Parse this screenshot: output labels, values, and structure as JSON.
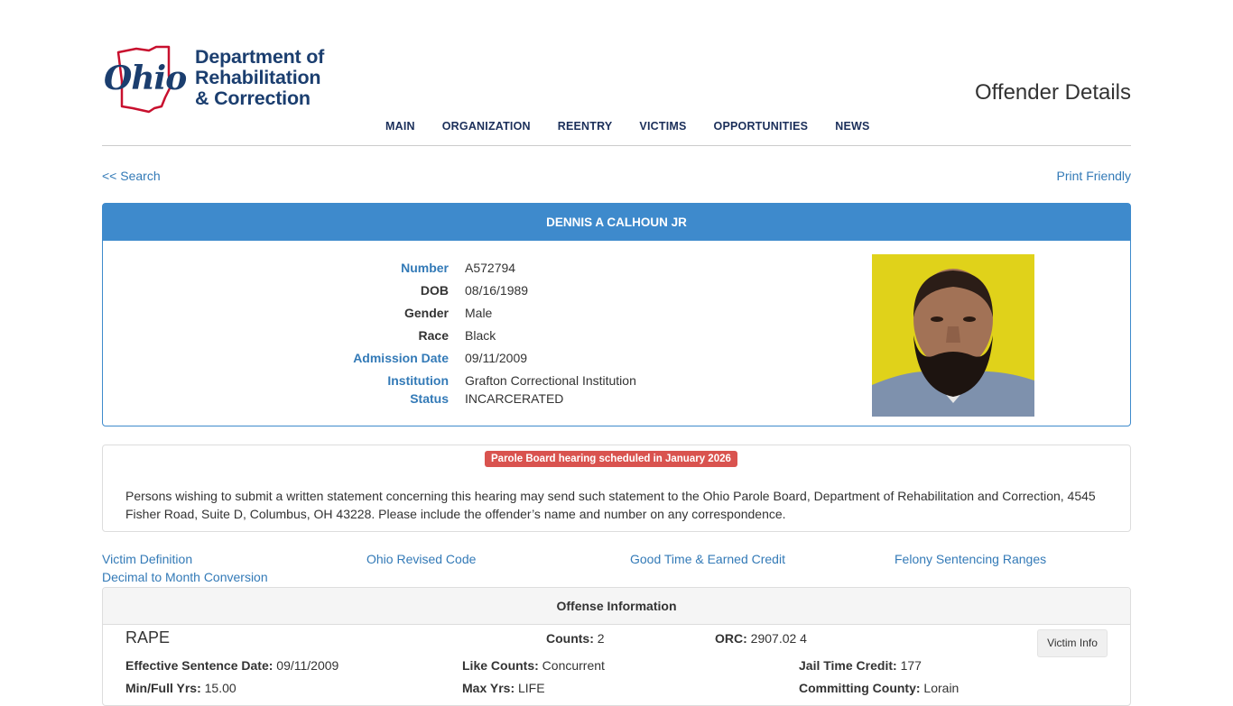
{
  "header": {
    "logo": {
      "script_word": "Ohio",
      "line1": "Department of",
      "line2": "Rehabilitation",
      "line3": "& Correction"
    },
    "page_title": "Offender Details",
    "nav": [
      "MAIN",
      "ORGANIZATION",
      "REENTRY",
      "VICTIMS",
      "OPPORTUNITIES",
      "NEWS"
    ]
  },
  "links": {
    "back": "<< Search",
    "print": "Print Friendly"
  },
  "offender": {
    "name": "DENNIS A CALHOUN JR",
    "fields": [
      {
        "label": "Number",
        "value": "A572794",
        "label_color": "blue"
      },
      {
        "label": "DOB",
        "value": "08/16/1989",
        "label_color": "dark"
      },
      {
        "label": "Gender",
        "value": "Male",
        "label_color": "dark"
      },
      {
        "label": "Race",
        "value": "Black",
        "label_color": "dark"
      },
      {
        "label": "Admission Date",
        "value": "09/11/2009",
        "label_color": "blue"
      },
      {
        "label": "Institution",
        "value": "Grafton Correctional Institution",
        "label_color": "blue"
      },
      {
        "label": "Status",
        "value": "INCARCERATED",
        "label_color": "blue"
      }
    ]
  },
  "parole": {
    "badge": "Parole Board hearing scheduled in January 2026",
    "text": "Persons wishing to submit a written statement concerning this hearing may send such statement to the Ohio Parole Board, Department of Rehabilitation and Correction, 4545 Fisher Road, Suite D, Columbus, OH 43228.  Please include the offender’s name and number on any correspondence."
  },
  "reference_links": [
    "Victim Definition",
    "Ohio Revised Code",
    "Good Time & Earned Credit",
    "Felony Sentencing Ranges",
    "Decimal to Month Conversion"
  ],
  "offense": {
    "heading": "Offense Information",
    "name": "RAPE",
    "counts_label": "Counts:",
    "counts": "2",
    "orc_label": "ORC:",
    "orc": "2907.02 4",
    "victim_button": "Victim Info",
    "effective_label": "Effective Sentence Date:",
    "effective": "09/11/2009",
    "like_counts_label": "Like Counts:",
    "like_counts": "Concurrent",
    "jail_credit_label": "Jail Time Credit:",
    "jail_credit": "177",
    "minfull_label": "Min/Full Yrs:",
    "minfull": "15.00",
    "max_label": "Max Yrs:",
    "max": "LIFE",
    "county_label": "Committing County:",
    "county": "Lorain"
  },
  "colors": {
    "brand_blue": "#1b3e6f",
    "link_blue": "#337ab7",
    "panel_blue": "#3e8acc",
    "badge_red": "#d9534f",
    "ohio_red": "#c8102e"
  }
}
